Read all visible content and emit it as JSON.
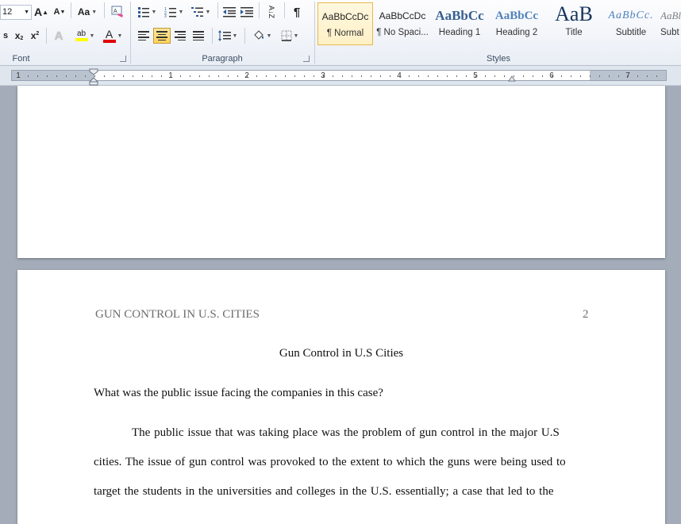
{
  "ribbon": {
    "font_size": "12",
    "font_group_label": "Font",
    "paragraph_group_label": "Paragraph",
    "styles_group_label": "Styles",
    "grow_font": "A",
    "shrink_font": "A",
    "change_case": "Aa",
    "subscript": "x",
    "superscript": "x",
    "highlight_sample": "ab",
    "font_color_sample": "A",
    "sort": "A↓Z",
    "pilcrow": "¶",
    "styles": [
      {
        "sample": "AaBbCcDc",
        "name": "¶ Normal"
      },
      {
        "sample": "AaBbCcDc",
        "name": "¶ No Spaci..."
      },
      {
        "sample": "AaBbCc",
        "name": "Heading 1"
      },
      {
        "sample": "AaBbCc",
        "name": "Heading 2"
      },
      {
        "sample": "AaB",
        "name": "Title"
      },
      {
        "sample": "AaBbCc.",
        "name": "Subtitle"
      },
      {
        "sample": "AaBl",
        "name": "Subt"
      }
    ]
  },
  "ruler": {
    "numbers": [
      "1",
      "1",
      "2",
      "3",
      "4",
      "5",
      "6",
      "7"
    ]
  },
  "document": {
    "running_head": "GUN CONTROL IN U.S. CITIES",
    "page_number": "2",
    "title": "Gun Control in U.S Cities",
    "question": "What was the public issue facing the companies in this case?",
    "body_lines": [
      "The public issue that was taking place was the problem of gun control in the major U.S",
      "cities. The issue of gun control was provoked to the extent to which the guns were being used to",
      "target the students in the universities and colleges in the U.S. essentially; a case that led to the"
    ]
  },
  "colors": {
    "ribbon_bg": "#e9eef5",
    "selected_style": "#ffd35a",
    "workspace": "#a3acb8",
    "highlight_yellow": "#ffff00",
    "font_color_red": "#e00000",
    "heading_blue": "#365f91"
  }
}
